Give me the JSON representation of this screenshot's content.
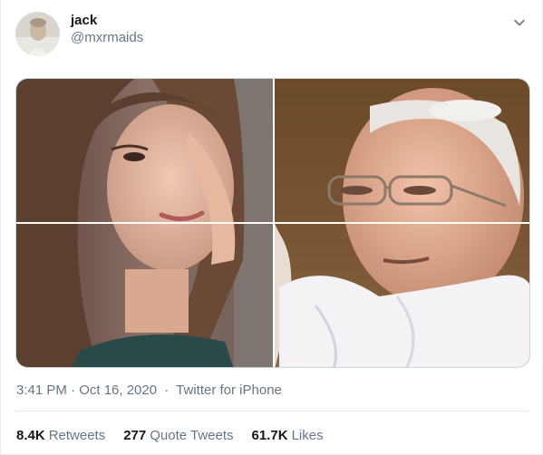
{
  "tweet": {
    "author": {
      "display_name": "jack",
      "handle": "@mxrmaids"
    },
    "timestamp": "3:41 PM · Oct 16, 2020",
    "separator": "·",
    "source": "Twitter for iPhone",
    "stats": [
      {
        "count": "8.4K",
        "label": "Retweets"
      },
      {
        "count": "277",
        "label": "Quote Tweets"
      },
      {
        "count": "61.7K",
        "label": "Likes"
      }
    ],
    "more_icon": "chevron-down-icon"
  },
  "colors": {
    "text_primary": "#14171a",
    "text_secondary": "#657786",
    "border": "#e6ecf0"
  }
}
